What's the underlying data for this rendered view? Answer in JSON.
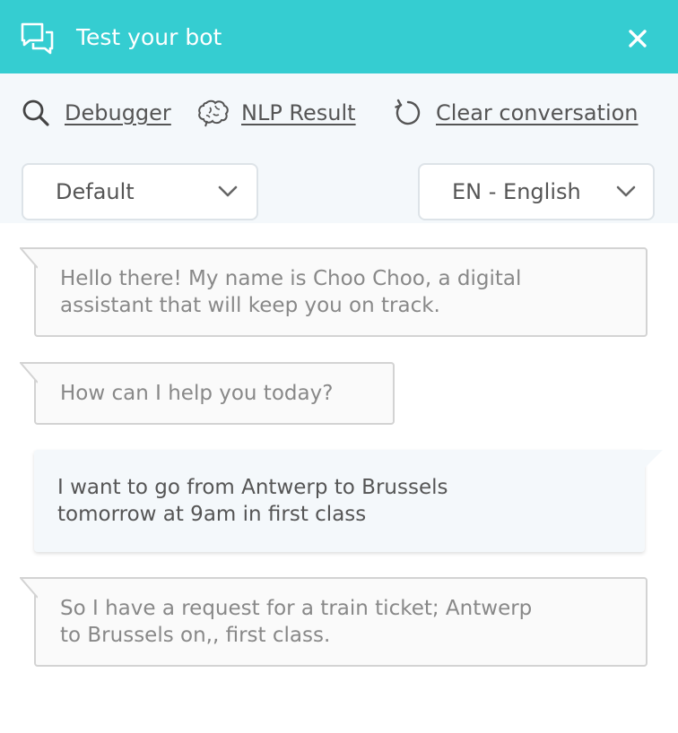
{
  "header": {
    "title": "Test your bot",
    "background": "#35cdd1",
    "icon": "chat-bubbles-icon",
    "close_icon": "close-icon"
  },
  "toolbar": {
    "debugger_label": "Debugger",
    "debugger_icon": "search-icon",
    "nlp_label": "NLP Result",
    "nlp_icon": "brain-icon",
    "clear_label": "Clear conversation",
    "clear_icon": "refresh-icon"
  },
  "selectors": {
    "flow": "Default",
    "language": "EN - English"
  },
  "conversation": [
    {
      "from": "bot",
      "text": "Hello there! My name is Choo Choo, a digital\nassistant that will keep you on track."
    },
    {
      "from": "bot",
      "text": "How can I help you today?"
    },
    {
      "from": "user",
      "text": "I want to go from Antwerp to Brussels\ntomorrow at 9am in first class"
    },
    {
      "from": "bot",
      "text": "So I have a request for a train ticket; Antwerp\nto Brussels on,, first class."
    }
  ]
}
